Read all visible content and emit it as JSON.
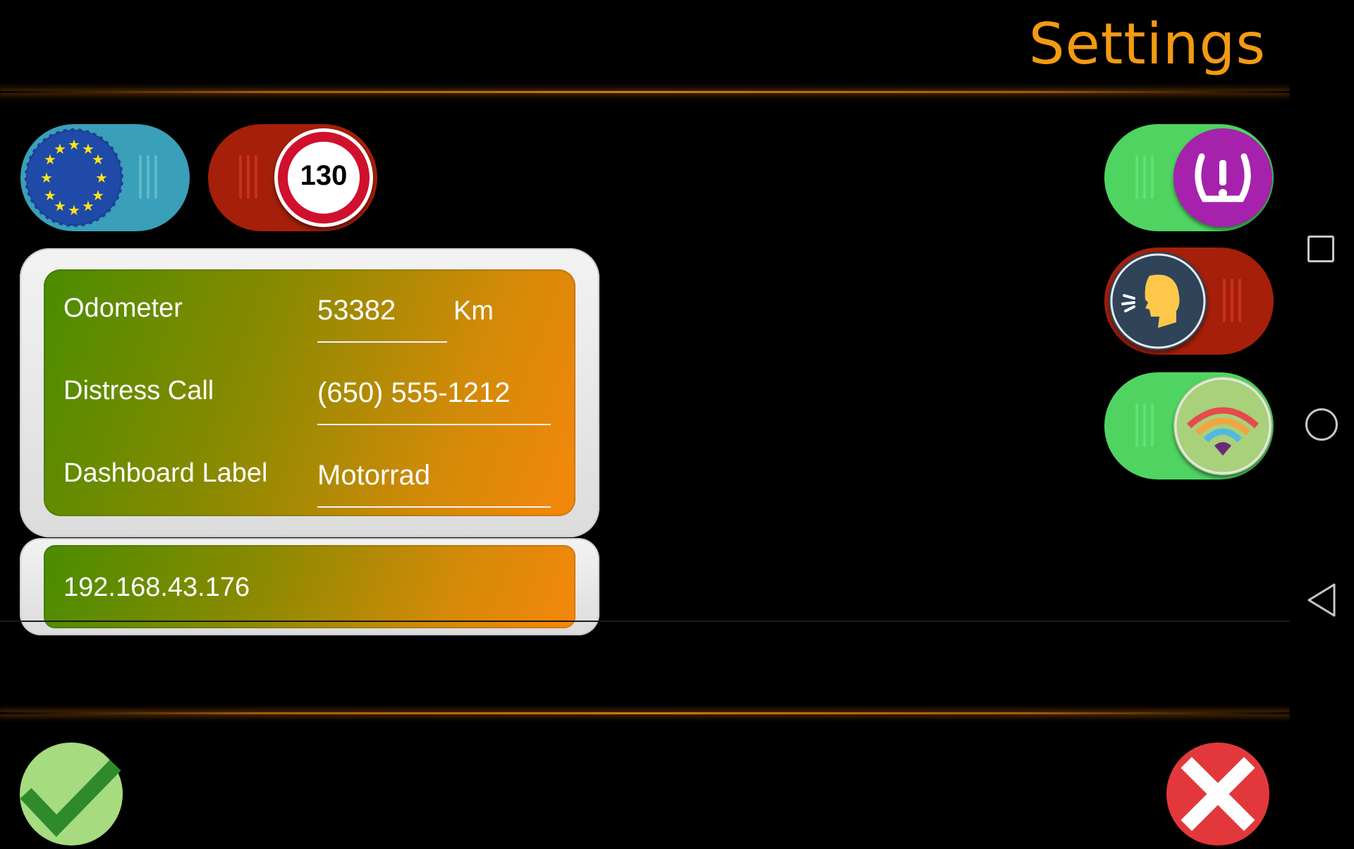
{
  "header": {
    "title": "Settings"
  },
  "toggles": {
    "region_eu": {
      "icon": "eu-flag-icon",
      "state": "off"
    },
    "speed_limit": {
      "icon": "speed-limit-sign-icon",
      "badge_text": "130",
      "state": "on"
    },
    "tire_pressure": {
      "icon": "tire-pressure-warning-icon",
      "state": "on"
    },
    "voice": {
      "icon": "speaking-head-icon",
      "state": "off"
    },
    "wifi": {
      "icon": "wifi-icon",
      "state": "on"
    }
  },
  "form": {
    "odometer_label": "Odometer",
    "odometer_value": "53382",
    "odometer_unit": "Km",
    "distress_label": "Distress Call",
    "distress_value": "(650) 555-1212",
    "dashboard_label": "Dashboard Label",
    "dashboard_value": "Motorrad"
  },
  "network": {
    "ip_address": "192.168.43.176"
  },
  "actions": {
    "confirm_icon": "checkmark-icon",
    "cancel_icon": "close-x-icon"
  },
  "colors": {
    "accent": "#f39a12",
    "toggle_on": "#4fd462",
    "toggle_off": "#a51f0a",
    "toggle_blue": "#3a9fb8"
  },
  "system_nav": {
    "recents_icon": "square-icon",
    "home_icon": "circle-icon",
    "back_icon": "triangle-back-icon"
  }
}
